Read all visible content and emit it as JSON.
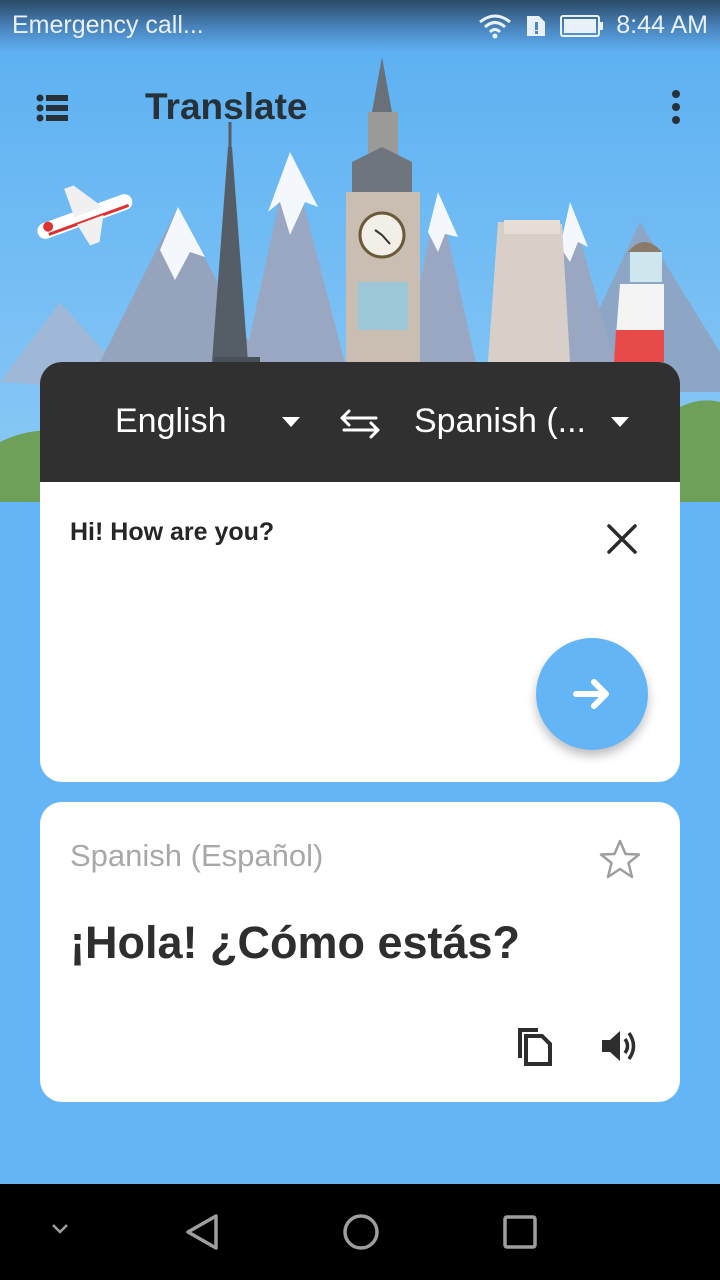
{
  "status_bar": {
    "carrier_text": "Emergency call...",
    "time": "8:44 AM",
    "icons": [
      "wifi-icon",
      "sim-alert-icon",
      "battery-icon"
    ]
  },
  "app_bar": {
    "title": "Translate",
    "menu_icon": "list-menu-icon",
    "more_icon": "more-vertical-icon"
  },
  "language_bar": {
    "source_language": "English",
    "target_language": "Spanish (...",
    "swap_icon": "swap-arrows-icon",
    "dropdown_icon": "triangle-down-icon"
  },
  "input": {
    "text": "Hi! How are you?",
    "clear_icon": "close-icon",
    "translate_icon": "arrow-right-icon"
  },
  "result": {
    "language_label": "Spanish (Español)",
    "translated_text": "¡Hola! ¿Cómo estás?",
    "favorite_icon": "star-outline-icon",
    "copy_icon": "copy-icon",
    "speak_icon": "speaker-icon"
  },
  "colors": {
    "accent": "#64b5f6",
    "lang_bar": "#303030",
    "card": "#ffffff",
    "muted_text": "#a8a8a8"
  },
  "nav_bar": {
    "items": [
      "collapse-icon",
      "back-icon",
      "home-icon",
      "recents-icon"
    ]
  }
}
